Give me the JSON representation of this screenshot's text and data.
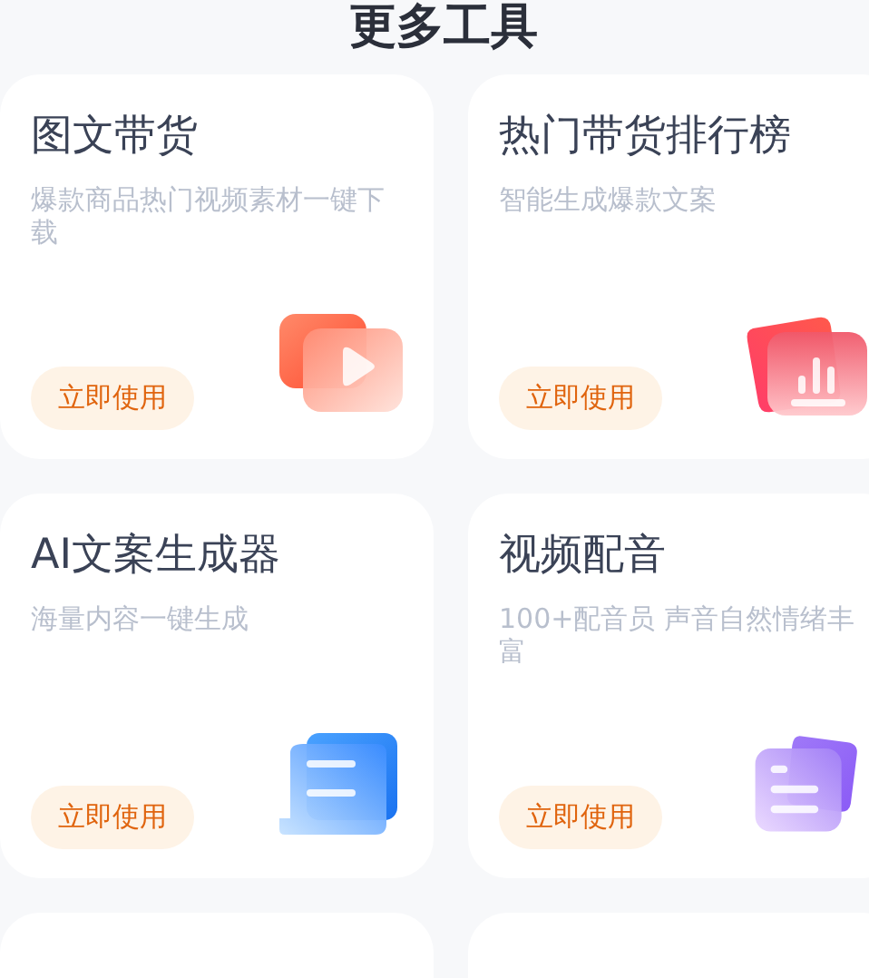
{
  "header": {
    "title": "更多工具"
  },
  "tools": [
    {
      "title": "图文带货",
      "description": "爆款商品热门视频素材一键下载",
      "button": "立即使用"
    },
    {
      "title": "热门带货排行榜",
      "description": "智能生成爆款文案",
      "button": "立即使用"
    },
    {
      "title": "AI文案生成器",
      "description": "海量内容一键生成",
      "button": "立即使用"
    },
    {
      "title": "视频配音",
      "description": "100+配音员 声音自然情绪丰富",
      "button": "立即使用"
    }
  ]
}
